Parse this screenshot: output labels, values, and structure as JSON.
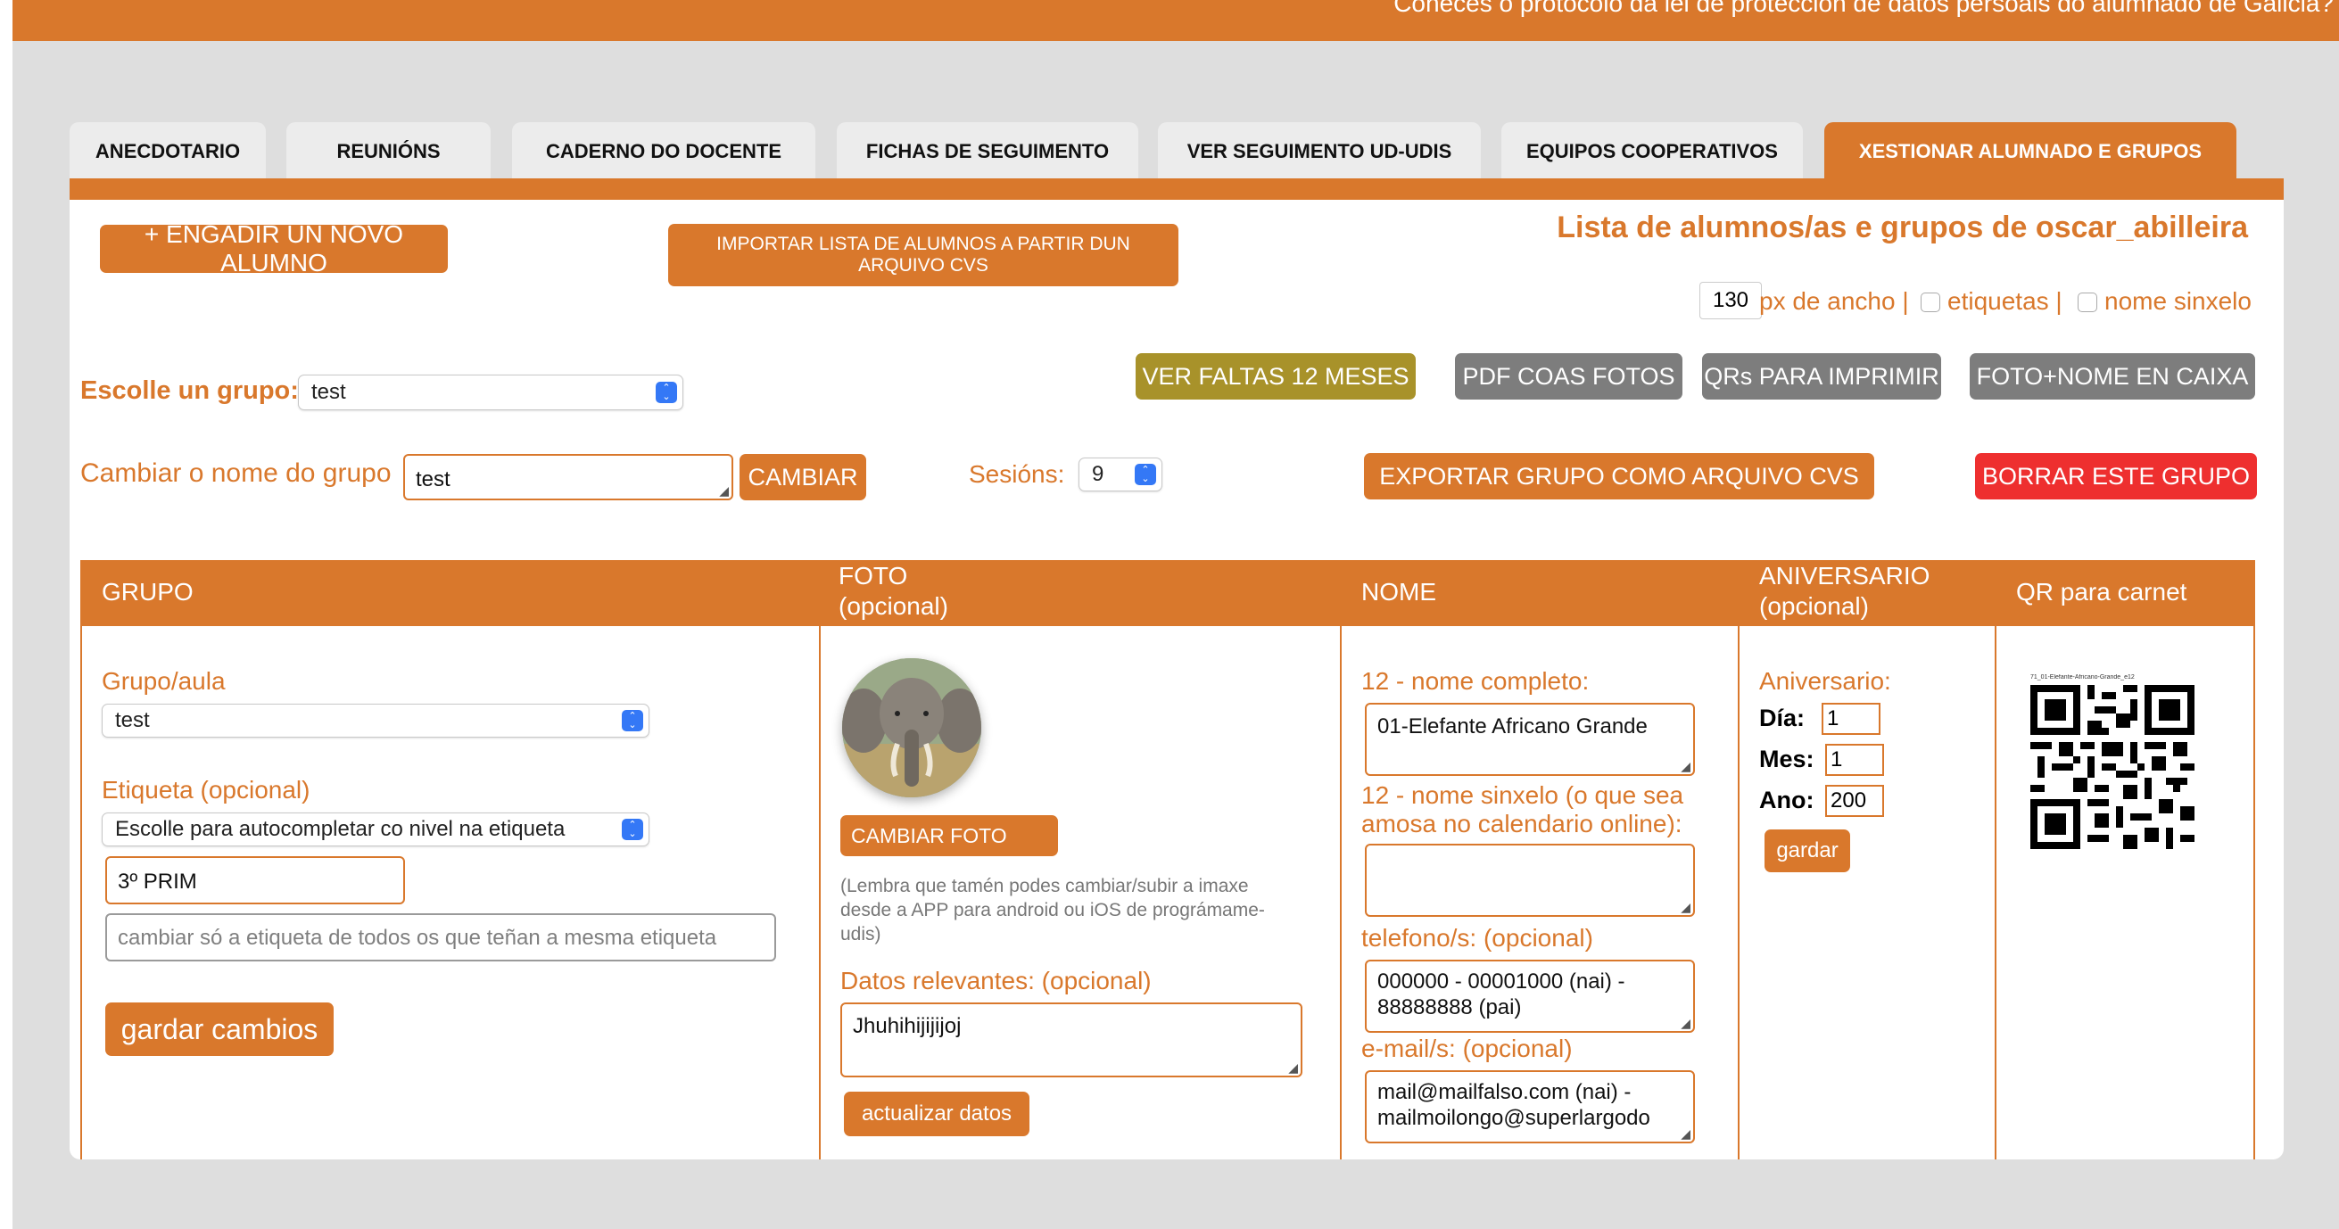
{
  "topbar": {
    "text": "Coñeces o protocolo da lei de protección de datos persoais do alumnado de Galicia?"
  },
  "tabs": [
    {
      "label": "ANECDOTARIO"
    },
    {
      "label": "REUNIÓNS"
    },
    {
      "label": "CADERNO DO DOCENTE"
    },
    {
      "label": "FICHAS DE SEGUIMENTO"
    },
    {
      "label": "VER SEGUIMENTO UD-UDIS"
    },
    {
      "label": "EQUIPOS COOPERATIVOS"
    },
    {
      "label": "XESTIONAR ALUMNADO E GRUPOS"
    }
  ],
  "toolbar": {
    "add_student": "+ ENGADIR UN NOVO ALUMNO",
    "import_line1": "IMPORTAR LISTA DE ALUMNOS A PARTIR DUN",
    "import_line2": "ARQUIVO CVS",
    "title": "Lista de alumnos/as e grupos de oscar_abilleira",
    "width_value": "130",
    "width_text": "px de ancho |",
    "labels_text": "etiquetas |",
    "simple_name_text": "nome sinxelo",
    "btn_absences": "VER FALTAS 12 MESES",
    "btn_pdf": "PDF COAS FOTOS",
    "btn_qrs": "QRs PARA IMPRIMIR",
    "btn_photo_name": "FOTO+NOME EN CAIXA",
    "choose_group_label": "Escolle un grupo:",
    "group_selected": "test",
    "rename_label": "Cambiar o nome do grupo",
    "rename_value": "test",
    "rename_button": "CAMBIAR",
    "sessions_label": "Sesións:",
    "sessions_value": "9",
    "export_button": "EXPORTAR GRUPO COMO ARQUIVO CVS",
    "delete_button": "BORRAR ESTE GRUPO"
  },
  "table": {
    "headers": {
      "group": "GRUPO",
      "photo_line1": "FOTO",
      "photo_line2": "(opcional)",
      "name": "NOME",
      "birthday_line1": "ANIVERSARIO",
      "birthday_line2": "(opcional)",
      "qr": "QR para carnet"
    },
    "row": {
      "group_label": "Grupo/aula",
      "group_value": "test",
      "tag_label": "Etiqueta (opcional)",
      "tag_select": "Escolle para autocompletar co nivel na etiqueta",
      "tag_value": "3º PRIM",
      "tag_all_placeholder": "cambiar só a etiqueta de todos os que teñan a mesma etiqueta",
      "save_changes": "gardar cambios",
      "change_photo": "CAMBIAR FOTO",
      "photo_note": "(Lembra que tamén podes cambiar/subir a imaxe desde a APP para android ou iOS de prográmame-udis)",
      "relevant_label": "Datos relevantes: (opcional)",
      "relevant_value": "Jhuhihijijijoj",
      "update_data": "actualizar datos",
      "full_name_label": "12 - nome completo:",
      "full_name_value": "01-Elefante Africano Grande",
      "simple_name_label": "12 - nome sinxelo (o que sea amosa no calendario online):",
      "simple_name_value": "",
      "phone_label": "telefono/s: (opcional)",
      "phone_value": "000000 - 00001000 (nai) - 88888888 (pai)",
      "email_label": "e-mail/s: (opcional)",
      "email_value": "mail@mailfalso.com (nai) - mailmoilongo@superlargodo",
      "birthday_label": "Aniversario:",
      "day_label": "Día:",
      "day_value": "1",
      "month_label": "Mes:",
      "month_value": "1",
      "year_label": "Ano:",
      "year_value": "200",
      "save_birthday": "gardar",
      "qr_caption": "71_01-Elefante-Africano-Grande_e12"
    }
  },
  "colors": {
    "accent": "#d9782c",
    "gray_button": "#7d7d7d",
    "olive_button": "#a8922a",
    "danger": "#ee2f2f",
    "background": "#dedede"
  }
}
